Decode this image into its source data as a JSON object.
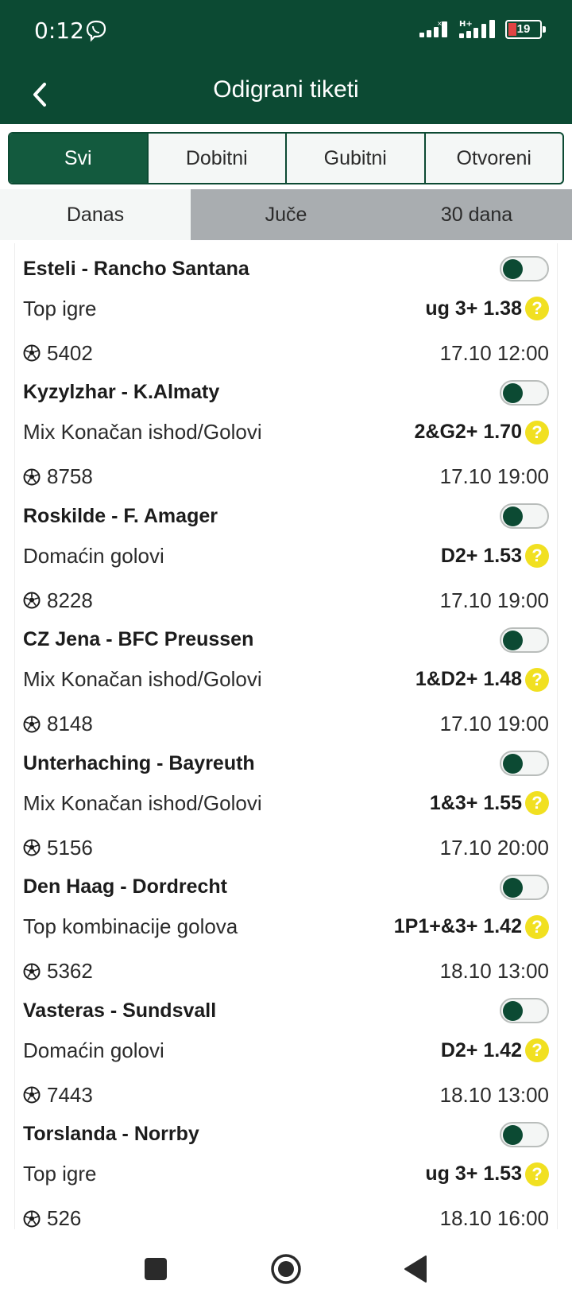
{
  "status_bar": {
    "time": "0:12",
    "battery": "19",
    "network_label": "H+"
  },
  "app_bar": {
    "title": "Odigrani tiketi"
  },
  "filter_tabs": [
    "Svi",
    "Dobitni",
    "Gubitni",
    "Otvoreni"
  ],
  "period_tabs": [
    "Danas",
    "Juče",
    "30 dana"
  ],
  "matches": [
    {
      "name": "Esteli - Rancho Santana",
      "market": "Top igre",
      "pick": "ug 3+ 1.38",
      "code": "5402",
      "datetime": "17.10 12:00"
    },
    {
      "name": "Kyzylzhar - K.Almaty",
      "market": "Mix Konačan ishod/Golovi",
      "pick": "2&G2+ 1.70",
      "code": "8758",
      "datetime": "17.10 19:00"
    },
    {
      "name": "Roskilde - F. Amager",
      "market": "Domaćin golovi",
      "pick": "D2+ 1.53",
      "code": "8228",
      "datetime": "17.10 19:00"
    },
    {
      "name": "CZ Jena - BFC Preussen",
      "market": "Mix Konačan ishod/Golovi",
      "pick": "1&D2+ 1.48",
      "code": "8148",
      "datetime": "17.10 19:00"
    },
    {
      "name": "Unterhaching - Bayreuth",
      "market": "Mix Konačan ishod/Golovi",
      "pick": "1&3+ 1.55",
      "code": "5156",
      "datetime": "17.10 20:00"
    },
    {
      "name": "Den Haag - Dordrecht",
      "market": "Top kombinacije golova",
      "pick": "1P1+&3+ 1.42",
      "code": "5362",
      "datetime": "18.10 13:00"
    },
    {
      "name": "Vasteras - Sundsvall",
      "market": "Domaćin golovi",
      "pick": "D2+ 1.42",
      "code": "7443",
      "datetime": "18.10 13:00"
    },
    {
      "name": "Torslanda - Norrby",
      "market": "Top igre",
      "pick": "ug 3+ 1.53",
      "code": "526",
      "datetime": "18.10 16:00"
    }
  ],
  "help_glyph": "?",
  "colors": {
    "header": "#0c4a33",
    "active_tab": "#135a3e",
    "inactive_period": "#a9adb0",
    "help_badge": "#f1e021"
  }
}
